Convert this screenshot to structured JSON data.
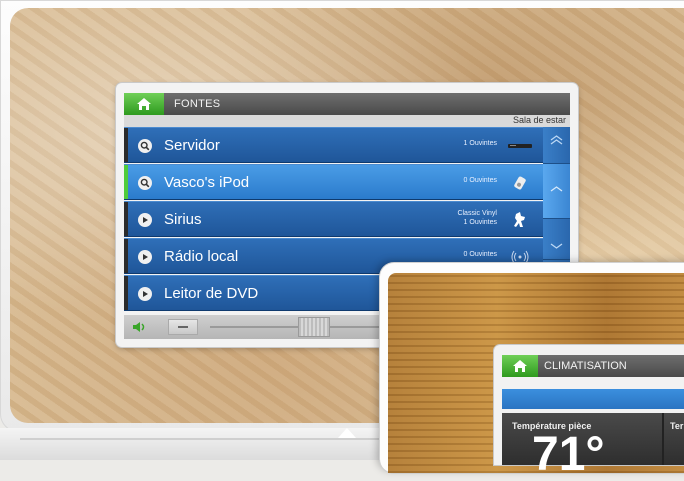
{
  "sources_panel": {
    "title": "FONTES",
    "room": "Sala de estar",
    "items": [
      {
        "name": "Servidor",
        "info": "1 Ouvintes",
        "device_icon": "server-icon",
        "selected": false
      },
      {
        "name": "Vasco's iPod",
        "info": "0 Ouvintes",
        "device_icon": "ipod-icon",
        "selected": true
      },
      {
        "name": "Sirius",
        "info_line1": "Classic Vinyl",
        "info_line2": "1 Ouvintes",
        "device_icon": "sirius-dog-icon",
        "selected": false
      },
      {
        "name": "Rádio local",
        "info": "0 Ouvintes",
        "device_icon": "radio-waves-icon",
        "selected": false
      },
      {
        "name": "Leitor de DVD",
        "device_icon": "dvd-icon",
        "selected": false
      }
    ],
    "footer": {
      "volume_icon": "speaker-icon",
      "minus_icon": "minus-icon"
    }
  },
  "climate_panel": {
    "title": "CLIMATISATION",
    "room_temp_label": "Température pièce",
    "second_label": "Ter",
    "temperature": "71°"
  },
  "colors": {
    "accent_green": "#4fcc3a",
    "list_blue": "#1f5699",
    "selected_blue": "#2b7bcc",
    "header_grey": "#4a4a4a"
  }
}
